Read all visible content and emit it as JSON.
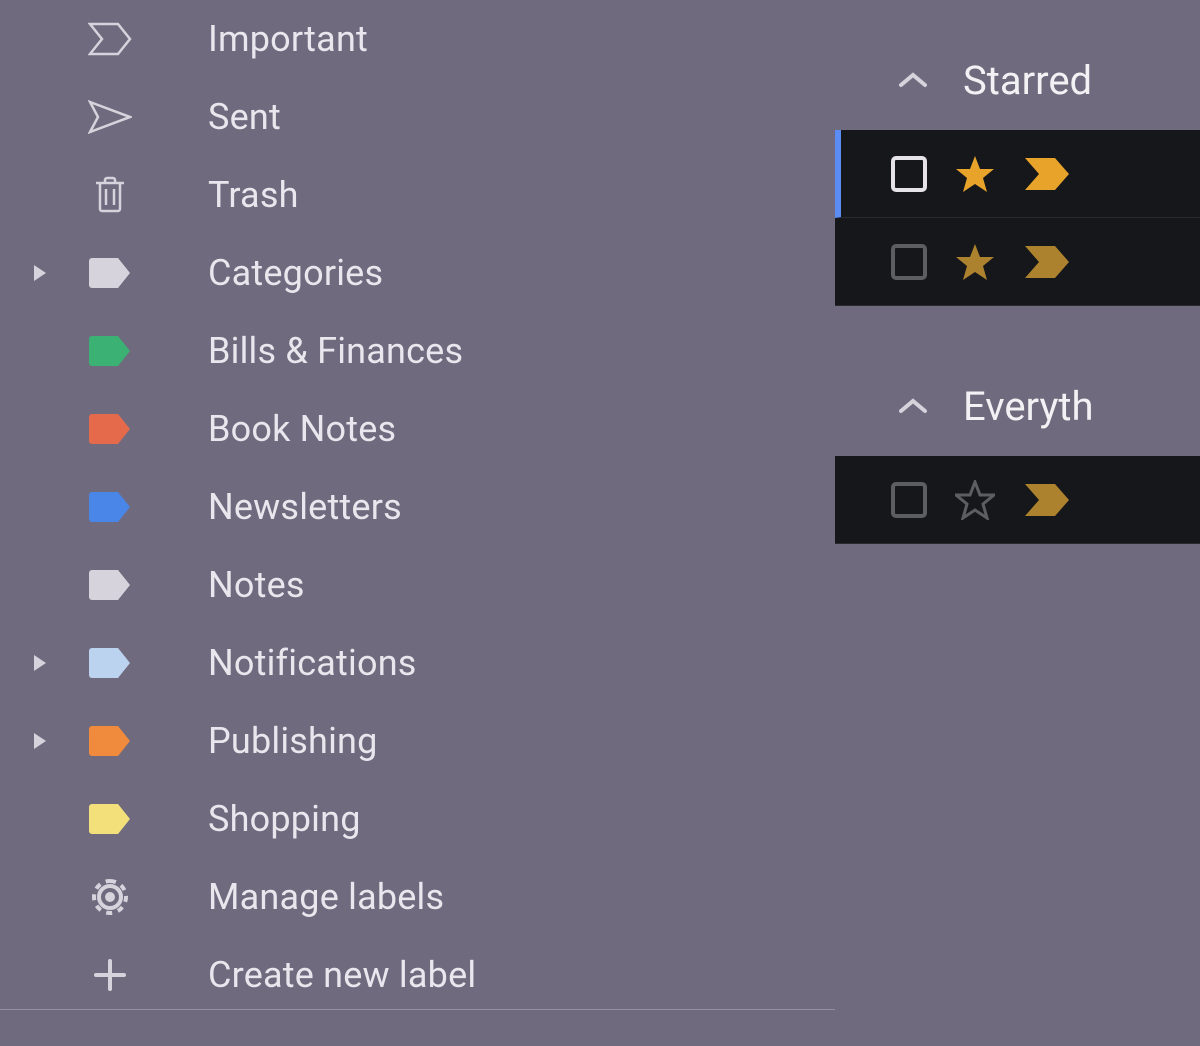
{
  "sidebar": {
    "items": [
      {
        "icon": "important",
        "label": "Important",
        "expandable": false
      },
      {
        "icon": "sent",
        "label": "Sent",
        "expandable": false
      },
      {
        "icon": "trash",
        "label": "Trash",
        "expandable": false
      },
      {
        "icon": "label",
        "label": "Categories",
        "color": "#d6d3dc",
        "expandable": true
      },
      {
        "icon": "label",
        "label": "Bills & Finances",
        "color": "#3bb273",
        "expandable": false
      },
      {
        "icon": "label",
        "label": "Book Notes",
        "color": "#e56a4b",
        "expandable": false
      },
      {
        "icon": "label",
        "label": "Newsletters",
        "color": "#4a86e8",
        "expandable": false
      },
      {
        "icon": "label",
        "label": "Notes",
        "color": "#d6d3dc",
        "expandable": false
      },
      {
        "icon": "label",
        "label": "Notifications",
        "color": "#bcd3f0",
        "expandable": true
      },
      {
        "icon": "label",
        "label": "Publishing",
        "color": "#f08a3c",
        "expandable": true
      },
      {
        "icon": "label",
        "label": "Shopping",
        "color": "#f3e07b",
        "expandable": false
      },
      {
        "icon": "gear",
        "label": "Manage labels",
        "expandable": false
      },
      {
        "icon": "plus",
        "label": "Create new label",
        "expandable": false
      }
    ]
  },
  "sections": [
    {
      "title": "Starred",
      "rows": [
        {
          "checked": false,
          "starred": true,
          "important": true,
          "selected": true,
          "checkboxBright": true
        },
        {
          "checked": false,
          "starred": true,
          "important": true,
          "selected": false,
          "checkboxBright": false
        }
      ]
    },
    {
      "title": "Everyth",
      "rows": [
        {
          "checked": false,
          "starred": false,
          "important": true,
          "selected": false,
          "checkboxBright": false
        }
      ]
    }
  ],
  "colors": {
    "starFilled": "#e8a32b",
    "starOutline": "#6d6e72",
    "importantFilled": "#cf9a33",
    "importantBright": "#e8a32b"
  }
}
